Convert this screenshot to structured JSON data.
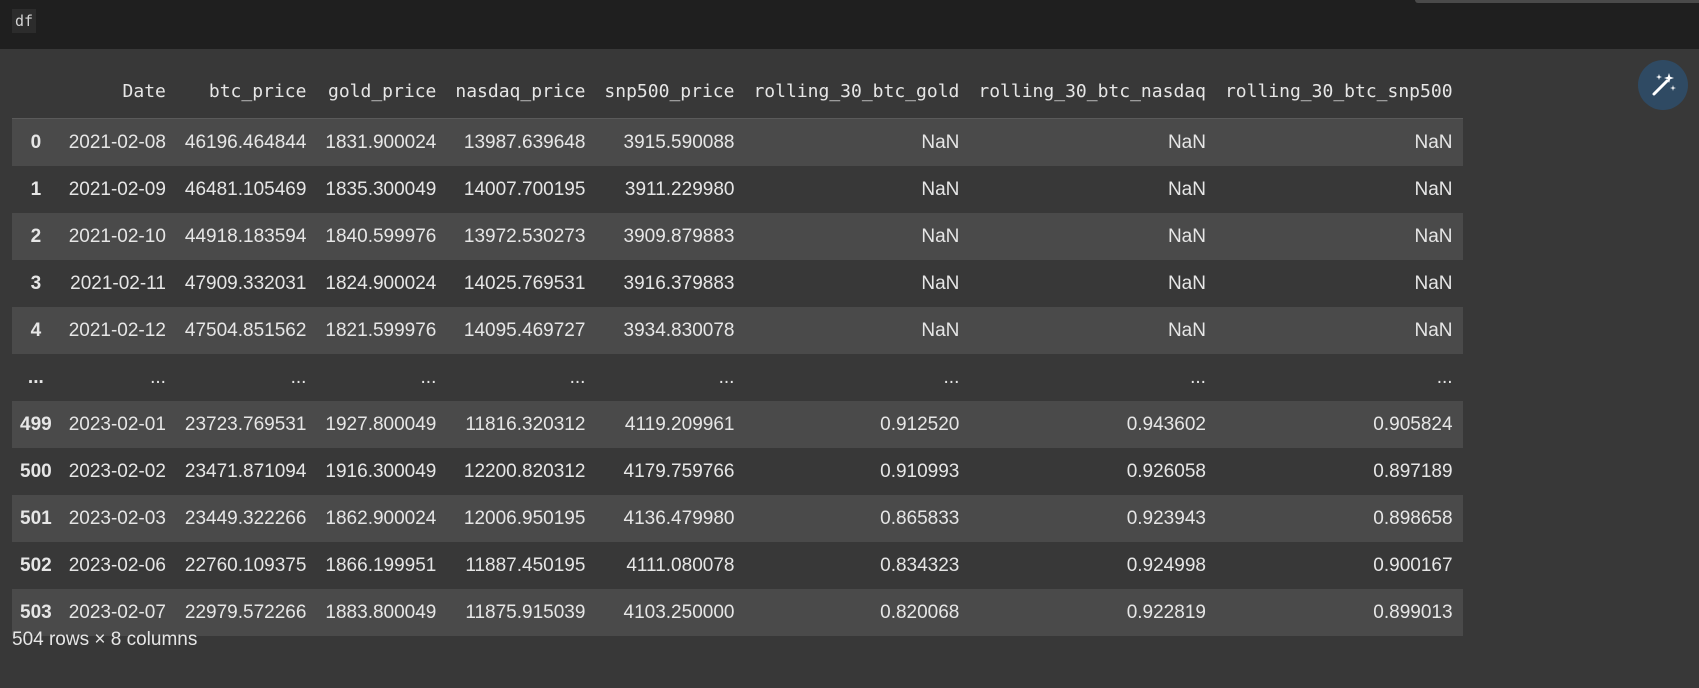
{
  "code_cell": {
    "source": "df"
  },
  "table": {
    "columns": [
      "",
      "Date",
      "btc_price",
      "gold_price",
      "nasdaq_price",
      "snp500_price",
      "rolling_30_btc_gold",
      "rolling_30_btc_nasdaq",
      "rolling_30_btc_snp500"
    ],
    "rows": [
      [
        "0",
        "2021-02-08",
        "46196.464844",
        "1831.900024",
        "13987.639648",
        "3915.590088",
        "NaN",
        "NaN",
        "NaN"
      ],
      [
        "1",
        "2021-02-09",
        "46481.105469",
        "1835.300049",
        "14007.700195",
        "3911.229980",
        "NaN",
        "NaN",
        "NaN"
      ],
      [
        "2",
        "2021-02-10",
        "44918.183594",
        "1840.599976",
        "13972.530273",
        "3909.879883",
        "NaN",
        "NaN",
        "NaN"
      ],
      [
        "3",
        "2021-02-11",
        "47909.332031",
        "1824.900024",
        "14025.769531",
        "3916.379883",
        "NaN",
        "NaN",
        "NaN"
      ],
      [
        "4",
        "2021-02-12",
        "47504.851562",
        "1821.599976",
        "14095.469727",
        "3934.830078",
        "NaN",
        "NaN",
        "NaN"
      ],
      [
        "...",
        "...",
        "...",
        "...",
        "...",
        "...",
        "...",
        "...",
        "..."
      ],
      [
        "499",
        "2023-02-01",
        "23723.769531",
        "1927.800049",
        "11816.320312",
        "4119.209961",
        "0.912520",
        "0.943602",
        "0.905824"
      ],
      [
        "500",
        "2023-02-02",
        "23471.871094",
        "1916.300049",
        "12200.820312",
        "4179.759766",
        "0.910993",
        "0.926058",
        "0.897189"
      ],
      [
        "501",
        "2023-02-03",
        "23449.322266",
        "1862.900024",
        "12006.950195",
        "4136.479980",
        "0.865833",
        "0.923943",
        "0.898658"
      ],
      [
        "502",
        "2023-02-06",
        "22760.109375",
        "1866.199951",
        "11887.450195",
        "4111.080078",
        "0.834323",
        "0.924998",
        "0.900167"
      ],
      [
        "503",
        "2023-02-07",
        "22979.572266",
        "1883.800049",
        "11875.915039",
        "4103.250000",
        "0.820068",
        "0.922819",
        "0.899013"
      ]
    ],
    "footer": "504 rows × 8 columns"
  },
  "colors": {
    "output_bg": "#383838",
    "row_striped": "#4a4a4a",
    "input_bg": "#1f1f1f",
    "magic_button_bg": "#2f4a63",
    "text": "#e6e6e6"
  },
  "icons": {
    "magic_button": "magic-wand-icon"
  }
}
